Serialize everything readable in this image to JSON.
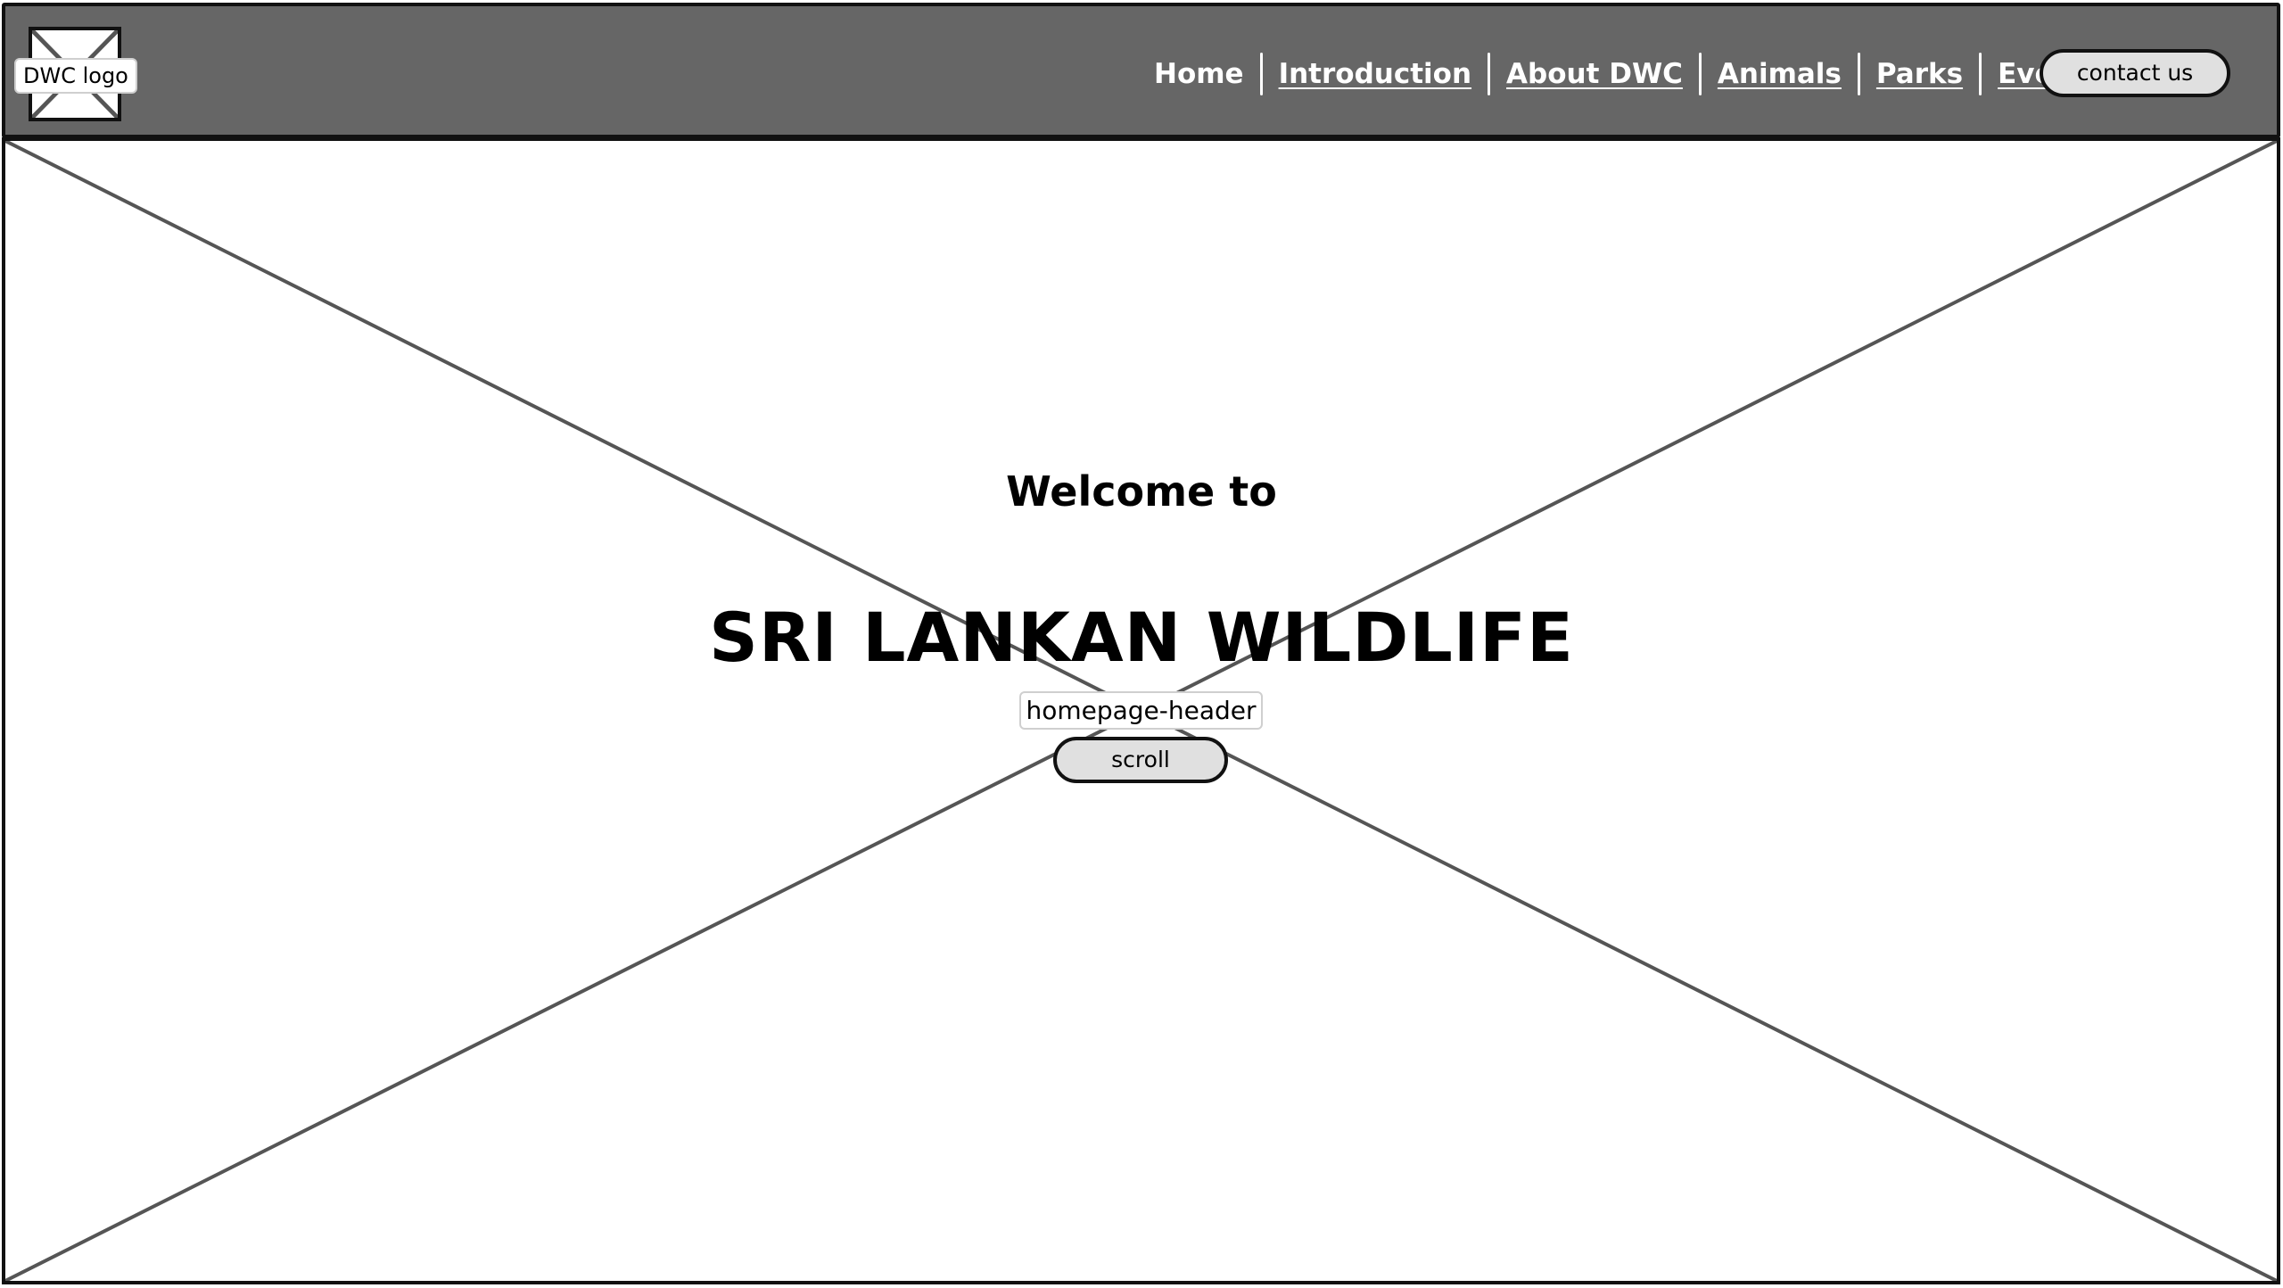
{
  "header": {
    "logo_label": "DWC logo",
    "nav_items": [
      {
        "label": "Home"
      },
      {
        "label": "Introduction"
      },
      {
        "label": "About DWC"
      },
      {
        "label": "Animals"
      },
      {
        "label": "Parks"
      },
      {
        "label": "Events"
      }
    ],
    "contact_label": "contact us"
  },
  "hero": {
    "welcome": "Welcome to",
    "title": "SRI LANKAN WILDLIFE",
    "section_label": "homepage-header",
    "scroll_label": "scroll"
  },
  "colors": {
    "navbar": "#666666",
    "button_fill": "#e0e0e0",
    "outline": "#111111",
    "placeholder_cross": "#555555"
  },
  "icons": {
    "logo": "image-placeholder-icon",
    "hero": "image-placeholder-icon"
  }
}
